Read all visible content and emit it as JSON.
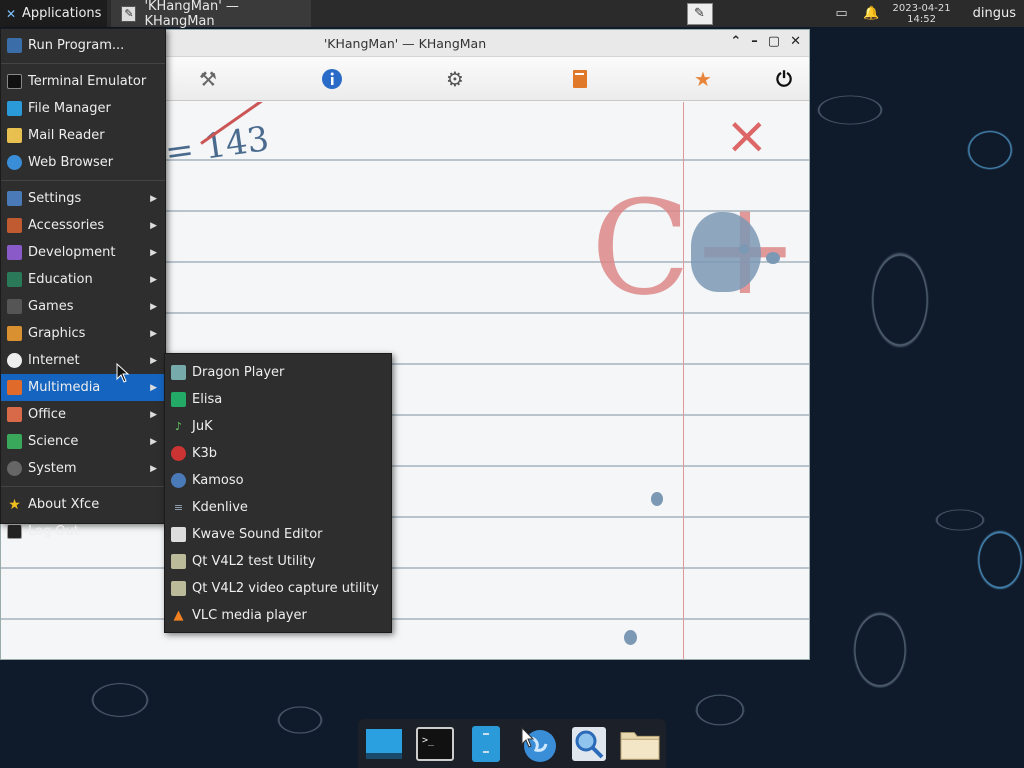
{
  "panel": {
    "apps_label": "Applications",
    "task_title": "'KHangMan' — KHangMan",
    "clock_date": "2023-04-21",
    "clock_time": "14:52",
    "user": "dingus",
    "icons": [
      "battery-icon",
      "notification-bell-icon"
    ]
  },
  "window": {
    "title": "'KHangMan' — KHangMan",
    "controls": [
      "chevron-up-icon",
      "minimize-icon",
      "maximize-icon",
      "close-icon"
    ],
    "toolbar": [
      "tools-icon",
      "info-icon",
      "settings-gear-icon",
      "book-icon",
      "star-icon",
      "power-icon"
    ]
  },
  "game": {
    "score_text": "= 143",
    "grade_text": "C+",
    "miss_mark": "×"
  },
  "menu": {
    "items": [
      {
        "label": "Run Program...",
        "icon": "run-icon",
        "submenu": false
      },
      {
        "label": "Terminal Emulator",
        "icon": "terminal-icon",
        "submenu": false
      },
      {
        "label": "File Manager",
        "icon": "file-manager-icon",
        "submenu": false
      },
      {
        "label": "Mail Reader",
        "icon": "mail-icon",
        "submenu": false
      },
      {
        "label": "Web Browser",
        "icon": "web-browser-icon",
        "submenu": false
      },
      {
        "label": "Settings",
        "icon": "settings-icon",
        "submenu": true
      },
      {
        "label": "Accessories",
        "icon": "accessories-icon",
        "submenu": true
      },
      {
        "label": "Development",
        "icon": "development-icon",
        "submenu": true
      },
      {
        "label": "Education",
        "icon": "education-icon",
        "submenu": true
      },
      {
        "label": "Games",
        "icon": "games-icon",
        "submenu": true
      },
      {
        "label": "Graphics",
        "icon": "graphics-icon",
        "submenu": true
      },
      {
        "label": "Internet",
        "icon": "internet-icon",
        "submenu": true
      },
      {
        "label": "Multimedia",
        "icon": "multimedia-icon",
        "submenu": true
      },
      {
        "label": "Office",
        "icon": "office-icon",
        "submenu": true
      },
      {
        "label": "Science",
        "icon": "science-icon",
        "submenu": true
      },
      {
        "label": "System",
        "icon": "system-icon",
        "submenu": true
      },
      {
        "label": "About Xfce",
        "icon": "about-star-icon",
        "submenu": false
      },
      {
        "label": "Log Out",
        "icon": "logout-icon",
        "submenu": false
      }
    ],
    "active": "Multimedia"
  },
  "submenu": {
    "items": [
      {
        "label": "Dragon Player",
        "icon": "dragon-player-icon"
      },
      {
        "label": "Elisa",
        "icon": "elisa-icon"
      },
      {
        "label": "JuK",
        "icon": "juk-icon"
      },
      {
        "label": "K3b",
        "icon": "k3b-icon"
      },
      {
        "label": "Kamoso",
        "icon": "kamoso-icon"
      },
      {
        "label": "Kdenlive",
        "icon": "kdenlive-icon"
      },
      {
        "label": "Kwave Sound Editor",
        "icon": "kwave-icon"
      },
      {
        "label": "Qt V4L2 test Utility",
        "icon": "qv4l2-icon"
      },
      {
        "label": "Qt V4L2 video capture utility",
        "icon": "qvidcap-icon"
      },
      {
        "label": "VLC media player",
        "icon": "vlc-icon"
      }
    ]
  },
  "dock": [
    "show-desktop-icon",
    "terminal-icon",
    "file-manager-icon",
    "web-browser-icon",
    "search-icon",
    "folder-icon"
  ],
  "colors": {
    "accent": "#1565c0",
    "menu_bg": "#2e2e2e",
    "panel_bg": "#2b2b2b"
  }
}
